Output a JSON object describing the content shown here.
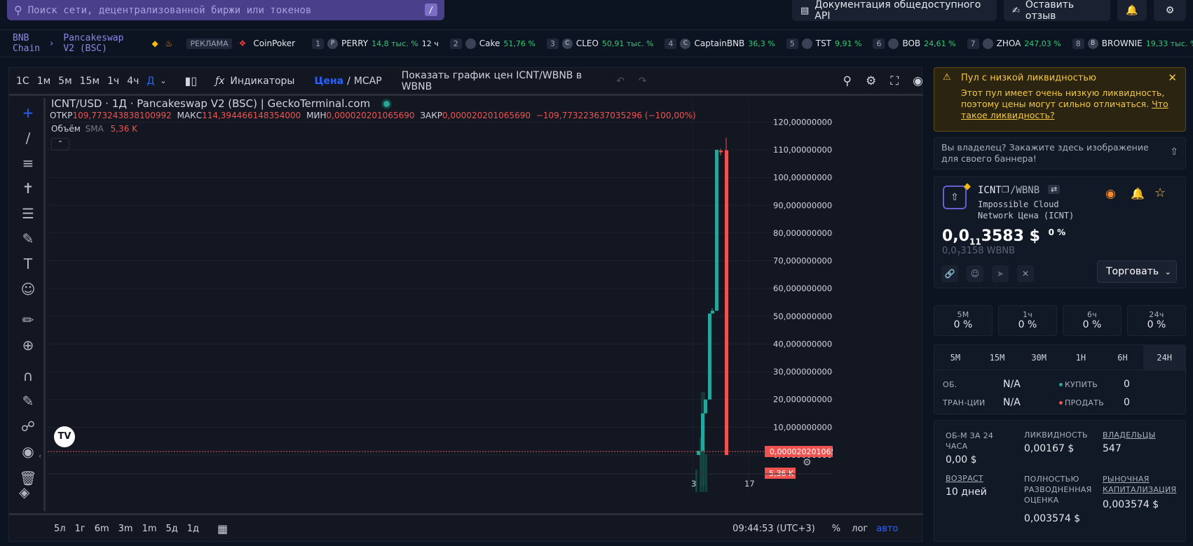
{
  "search": {
    "placeholder": "Поиск сети, децентрализованной биржи или токенов",
    "shortcut": "/"
  },
  "top_buttons": {
    "api_docs": "Документация общедоступного API",
    "feedback": "Оставить отзыв"
  },
  "breadcrumb": {
    "chain": "BNB Chain",
    "separator": "›",
    "dex": "Pancakeswap V2 (BSC)"
  },
  "ticker": {
    "ad_label": "РЕКЛАМА",
    "ad_name": "CoinPoker",
    "items": [
      {
        "rank": "1",
        "icon": "P",
        "name": "PERRY",
        "pct": "14,8 тыс. %",
        "extra": "12 ч"
      },
      {
        "rank": "",
        "icon": "cake",
        "name": "Cake",
        "pct": "51,76 %",
        "extra": ""
      },
      {
        "rank": "3",
        "icon": "C",
        "name": "CLEO",
        "pct": "50,91 тыс. %",
        "extra": ""
      },
      {
        "rank": "4",
        "icon": "C",
        "name": "CaptainBNB",
        "pct": "36,3 %",
        "extra": ""
      },
      {
        "rank": "5",
        "icon": "",
        "name": "TST",
        "pct": "9,91 %",
        "extra": ""
      },
      {
        "rank": "6",
        "icon": "",
        "name": "BOB",
        "pct": "24,61 %",
        "extra": ""
      },
      {
        "rank": "7",
        "icon": "",
        "name": "ZHOA",
        "pct": "247,03 %",
        "extra": ""
      },
      {
        "rank": "8",
        "icon": "B",
        "name": "BROWNIE",
        "pct": "19,33 тыс. %",
        "extra": ""
      }
    ],
    "cake_rank": "2"
  },
  "chart_toolbar": {
    "intervals": [
      "1С",
      "1м",
      "5м",
      "15м",
      "1ч",
      "4ч",
      "Д"
    ],
    "indicators": "Индикаторы",
    "price": "Цена",
    "slash": "/",
    "mcap": "MCAP",
    "show_in": "Показать график цен ICNT/WBNB в WBNB"
  },
  "chart_header": {
    "title": "ICNT/USD · 1Д · Pancakeswap V2 (BSC) | GeckoTerminal.com",
    "o_label": "ОТКР",
    "o": "109,773243838100992",
    "h_label": "МАКС",
    "h": "114,394466148354000",
    "l_label": "МИН",
    "l": "0,000020201065690",
    "c_label": "ЗАКР",
    "c": "0,000020201065690",
    "change": "−109,773223637035296 (−100,00%)",
    "vol_label": "Объём",
    "sma": "SMA",
    "vol": "5,36 K"
  },
  "chart_data": {
    "type": "candlestick",
    "y_ticks": [
      "120,000000000000000",
      "110,000000000000000",
      "100,000000000000000",
      "90,000000000000000",
      "80,000000000000000",
      "70,000000000000000",
      "60,000000000000000",
      "50,000000000000000",
      "40,000000000000000",
      "30,000000000000000",
      "20,000000000000000",
      "10,000000000000000",
      "0,000000000000000"
    ],
    "ylim": [
      0,
      120
    ],
    "x_ticks": [
      "3",
      "17"
    ],
    "last_price_label": "0,000020201065690",
    "last_volume_label": "5,36 K",
    "candles": [
      {
        "o": 0,
        "c": 1.5,
        "h": 1.5,
        "l": 0,
        "dir": "up"
      },
      {
        "o": 1.5,
        "c": 15,
        "h": 15,
        "l": 1.5,
        "dir": "up"
      },
      {
        "o": 15,
        "c": 20,
        "h": 20,
        "l": 15,
        "dir": "up"
      },
      {
        "o": 20,
        "c": 51,
        "h": 51,
        "l": 20,
        "dir": "up"
      },
      {
        "o": 51,
        "c": 52,
        "h": 53,
        "l": 51,
        "dir": "up"
      },
      {
        "o": 52,
        "c": 110,
        "h": 110,
        "l": 52,
        "dir": "up"
      },
      {
        "o": 109.7,
        "c": 109.1,
        "h": 110.4,
        "l": 108,
        "dir": "down"
      },
      {
        "o": 109.8,
        "c": 2e-05,
        "h": 114.39,
        "l": 2e-05,
        "dir": "down"
      }
    ]
  },
  "bottom_toolbar": {
    "ranges": [
      "5л",
      "1г",
      "6m",
      "3m",
      "1m",
      "5д",
      "1д"
    ],
    "time": "09:44:53 (UTC+3)",
    "pct": "%",
    "log": "лог",
    "auto": "авто"
  },
  "warning": {
    "title": "Пул с низкой ликвидностью",
    "text": "Этот пул имеет очень низкую ликвидность, поэтому цены могут сильно отличаться.",
    "link": "Что такое ликвидность?"
  },
  "banner_ad": {
    "text": "Вы владелец? Закажите здесь изображение для своего баннера!"
  },
  "token": {
    "base": "ICNT",
    "quote": "/WBNB",
    "name_line1": "Impossible Cloud",
    "name_line2": "Network Цена (ICNT)",
    "price_prefix": "0,0",
    "price_sub": "11",
    "price_tail": "3583 $",
    "change": "0 %",
    "wbnb_prefix": "0,0",
    "wbnb_sub": "7",
    "wbnb_tail": "3158 WBNB",
    "trade": "Торговать"
  },
  "changes": [
    {
      "label": "5М",
      "value": "0 %"
    },
    {
      "label": "1ч",
      "value": "0 %"
    },
    {
      "label": "6ч",
      "value": "0 %"
    },
    {
      "label": "24ч",
      "value": "0 %"
    }
  ],
  "tabs": [
    "5M",
    "15M",
    "30M",
    "1H",
    "6H",
    "24H"
  ],
  "txstats": {
    "vol_label": "ОБ.",
    "vol": "N/A",
    "tx_label": "ТРАН-ЦИИ",
    "tx": "N/A",
    "buy_label": "КУПИТЬ",
    "buy": "0",
    "sell_label": "ПРОДАТЬ",
    "sell": "0"
  },
  "stats": {
    "vol24_label": "ОБ-М ЗА 24 ЧАСА",
    "vol24": "0,00 $",
    "liq_label": "ЛИКВИДНОСТЬ",
    "liq": "0,00167 $",
    "holders_label": "ВЛАДЕЛЬЦЫ",
    "holders": "547",
    "age_label": "ВОЗРАСТ",
    "age": "10 дней",
    "fdv_label": "ПОЛНОСТЬЮ РАЗВОДНЕННАЯ ОЦЕНКА",
    "fdv": "0,003574 $",
    "mcap_label": "РЫНОЧНАЯ КАПИТАЛИЗАЦИЯ",
    "mcap": "0,003574 $"
  },
  "colors": {
    "up": "#26a69a",
    "down": "#ef5350",
    "accent": "#8e86e8",
    "warn": "#f5c842"
  }
}
